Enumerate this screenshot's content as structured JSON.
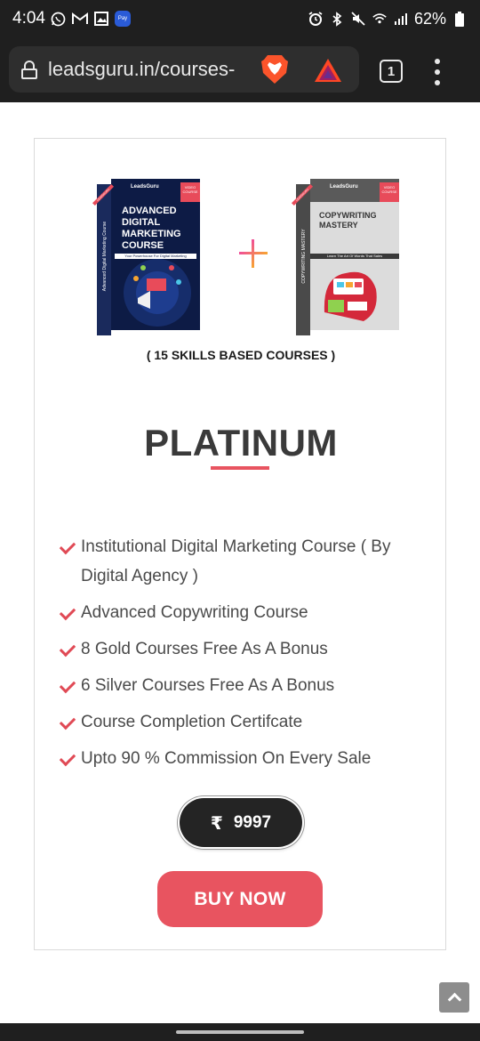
{
  "status_bar": {
    "time": "4:04",
    "battery": "62%",
    "icons_left": [
      "whatsapp-icon",
      "gmail-icon",
      "gallery-icon",
      "paytm-icon"
    ],
    "icons_right": [
      "alarm-icon",
      "bluetooth-icon",
      "mute-icon",
      "wifi-icon",
      "signal-icon",
      "battery-icon"
    ]
  },
  "browser": {
    "url": "leadsguru.in/courses-",
    "tab_count": "1"
  },
  "product": {
    "course1_box": {
      "brand": "LeadsGuru",
      "tag": "VIDEO COURSE",
      "title": "ADVANCED DIGITAL MARKETING COURSE",
      "subtitle": "Your Powerhouse For Digital Marketing",
      "spine": "Advanced Digital Marketing Course",
      "corner": "LEADSGURU"
    },
    "course2_box": {
      "brand": "LeadsGuru",
      "tag": "VIDEO COURSE",
      "title": "COPYWRITING MASTERY",
      "subtitle": "Learn The Art Of Words That Sales",
      "spine": "COPYWRITING MASTERY",
      "corner": "LEADSGURU"
    },
    "skills_caption": "( 15 SKILLS BASED COURSES )"
  },
  "plan": {
    "title": "PLATINUM",
    "accent_color": "#e85460"
  },
  "features": [
    "Institutional Digital Marketing Course ( By Digital Agency )",
    "Advanced Copywriting Course",
    "8 Gold Courses Free As A Bonus",
    "6 Silver Courses Free As A Bonus",
    "Course Completion Certifcate",
    "Upto 90 % Commission On Every Sale"
  ],
  "price": {
    "currency_symbol": "₹",
    "amount": "9997"
  },
  "cta": {
    "buy_label": "BUY NOW"
  }
}
